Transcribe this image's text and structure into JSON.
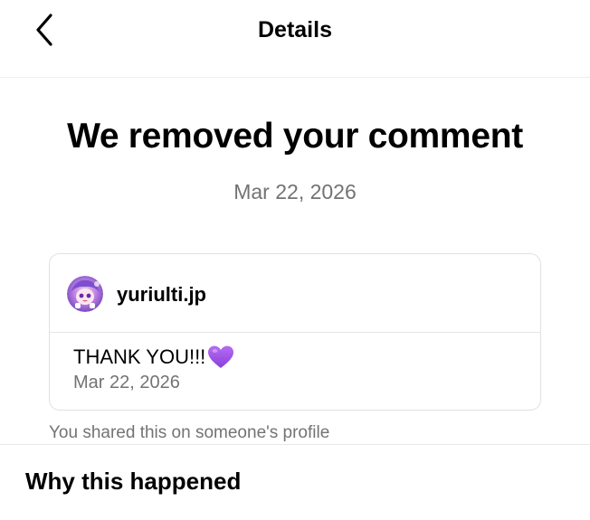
{
  "header": {
    "title": "Details",
    "back_icon": "chevron-left-icon"
  },
  "notice": {
    "title": "We removed your comment",
    "date": "Mar 22, 2026"
  },
  "comment_card": {
    "username": "yuriulti.jp",
    "comment_text": "THANK YOU!!!",
    "emoji": "purple-heart-icon",
    "comment_date": "Mar 22, 2026"
  },
  "shared_note": "You shared this on someone's profile",
  "section": {
    "heading": "Why this happened"
  },
  "colors": {
    "text": "#000000",
    "secondary_text": "#737373",
    "border": "#e1e1e1",
    "heart": "#9b4dea"
  }
}
